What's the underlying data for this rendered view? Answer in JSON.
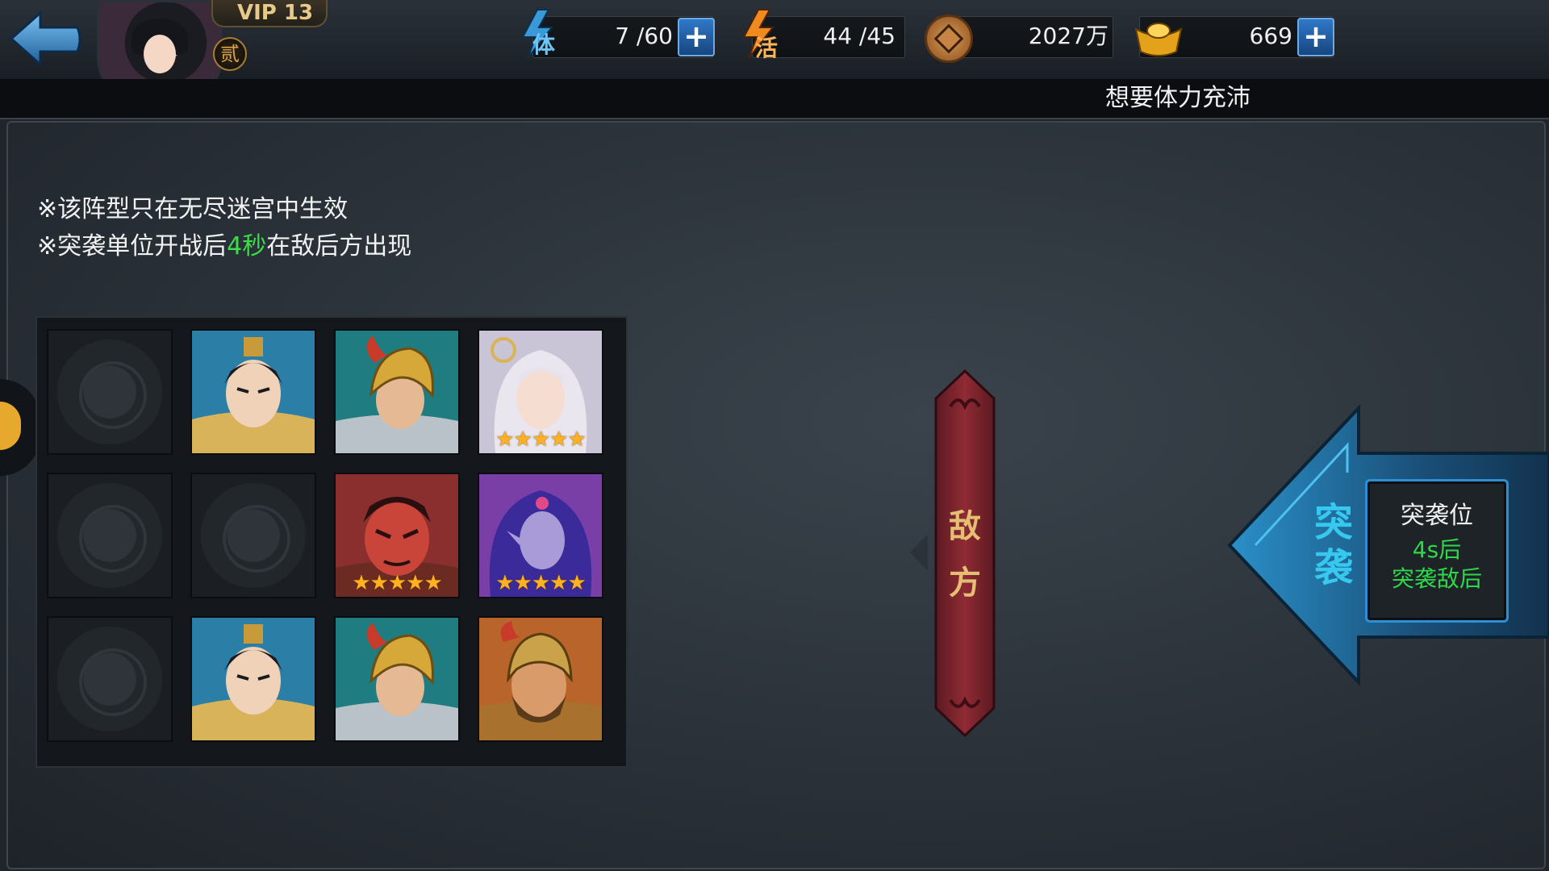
{
  "header": {
    "vip_label": "VIP 13",
    "rank_label": "贰",
    "stamina": {
      "label": "体",
      "value": "7 /60"
    },
    "vitality": {
      "label": "活",
      "value": "44 /45"
    },
    "coins": {
      "value": "2027万"
    },
    "ingots": {
      "value": "669"
    },
    "plus_symbol": "+",
    "banner_text": "想要体力充沛"
  },
  "notes": {
    "line1": "※该阵型只在无尽迷宫中生效",
    "line2_prefix": "※突袭单位开战后",
    "line2_highlight": "4秒",
    "line2_suffix": "在敌后方出现"
  },
  "formation": {
    "rows": [
      [
        {
          "hero": "empty"
        },
        {
          "hero": "young-warrior",
          "stars": 0
        },
        {
          "hero": "golden-helmet-knight",
          "stars": 0
        },
        {
          "hero": "silver-haired-maiden",
          "stars": 5
        }
      ],
      [
        {
          "hero": "empty"
        },
        {
          "hero": "empty"
        },
        {
          "hero": "red-faced-general",
          "stars": 5
        },
        {
          "hero": "purple-haired-elf",
          "stars": 5
        }
      ],
      [
        {
          "hero": "empty"
        },
        {
          "hero": "young-warrior",
          "stars": 0
        },
        {
          "hero": "golden-helmet-knight",
          "stars": 0
        },
        {
          "hero": "bearded-armored-general",
          "stars": 0
        }
      ]
    ],
    "star_glyphs": "★★★★★"
  },
  "enemy": {
    "char1": "敌",
    "char2": "方"
  },
  "raid": {
    "side_char1": "突",
    "side_char2": "袭",
    "slot_title": "突袭位",
    "slot_line1": "4s后",
    "slot_line2": "突袭敌后"
  },
  "colors": {
    "highlight_green": "#3ddc4a",
    "raid_blue": "#36c8ee",
    "enemy_gold": "#e4be72",
    "star_orange": "#ffb11f"
  }
}
